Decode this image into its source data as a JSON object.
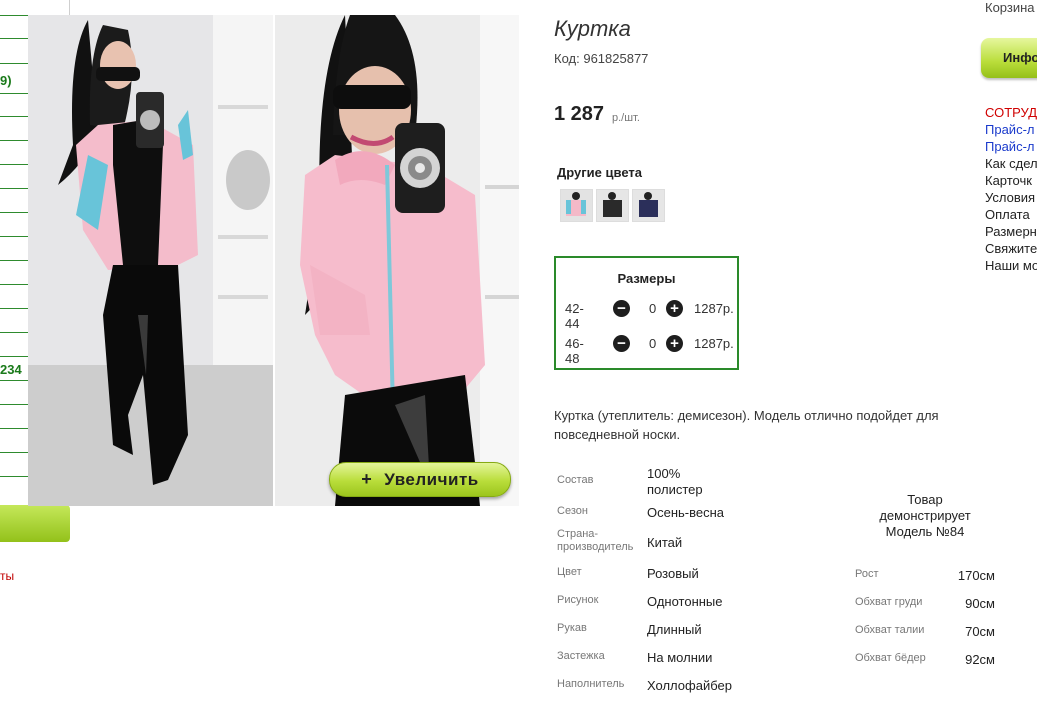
{
  "left_nav": {
    "fragments": [
      "9)",
      "234"
    ],
    "red_fragment": "ты"
  },
  "gallery": {
    "zoom_label": "Увеличить",
    "zoom_icon": "+"
  },
  "product": {
    "title": "Куртка",
    "code_label": "Код:",
    "code": "961825877",
    "price": "1 287",
    "price_unit": "р./шт.",
    "other_colors_title": "Другие цвета",
    "color_swatches": [
      {
        "name": "pink-blue",
        "color": "#f4b9c8"
      },
      {
        "name": "black",
        "color": "#2a2a2a"
      },
      {
        "name": "navy",
        "color": "#2b2f5a"
      }
    ]
  },
  "sizes": {
    "title": "Размеры",
    "rows": [
      {
        "size": "42-44",
        "qty": "0",
        "price": "1287р."
      },
      {
        "size": "46-48",
        "qty": "0",
        "price": "1287р."
      }
    ]
  },
  "description": "Куртка (утеплитель: демисезон). Модель отлично подойдет для повседневной носки.",
  "attributes": [
    {
      "key": "Состав",
      "value": "100% полистер"
    },
    {
      "key": "Сезон",
      "value": "Осень-весна"
    },
    {
      "key": "Страна-производитель",
      "value": "Китай"
    },
    {
      "key": "Цвет",
      "value": "Розовый"
    },
    {
      "key": "Рисунок",
      "value": "Однотонные"
    },
    {
      "key": "Рукав",
      "value": "Длинный"
    },
    {
      "key": "Застежка",
      "value": "На молнии"
    },
    {
      "key": "Наполнитель",
      "value": "Холлофайбер"
    }
  ],
  "model": {
    "title": "Товар демонстрирует Модель №84",
    "rows": [
      {
        "key": "Рост",
        "value": "170см"
      },
      {
        "key": "Обхват груди",
        "value": "90см"
      },
      {
        "key": "Обхват талии",
        "value": "70см"
      },
      {
        "key": "Обхват бёдер",
        "value": "92см"
      }
    ]
  },
  "right_column": {
    "cart": "Корзина",
    "info_tab": "Инфо",
    "links": [
      {
        "text": "СОТРУД",
        "style": "red"
      },
      {
        "text": "Прайс-л",
        "style": "blue"
      },
      {
        "text": "Прайс-л",
        "style": "blue"
      },
      {
        "text": "Как сдел",
        "style": "black"
      },
      {
        "text": "Карточк",
        "style": "black"
      },
      {
        "text": "Условия",
        "style": "black"
      },
      {
        "text": "Оплата",
        "style": "black"
      },
      {
        "text": "Размерн",
        "style": "black"
      },
      {
        "text": "Свяжите",
        "style": "black"
      },
      {
        "text": "Наши мо",
        "style": "black"
      }
    ]
  }
}
